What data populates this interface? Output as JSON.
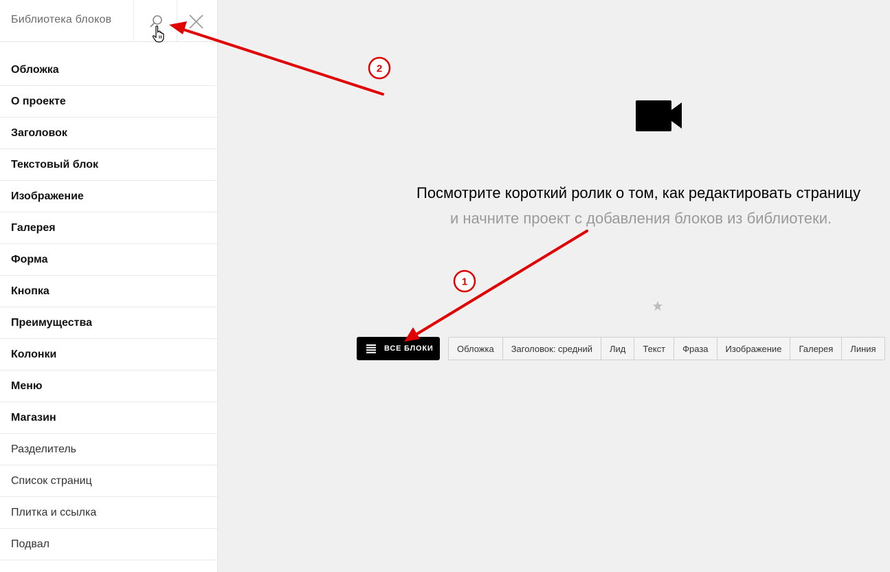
{
  "sidebar": {
    "title": "Библиотека блоков",
    "items": [
      {
        "label": "Обложка"
      },
      {
        "label": "О проекте"
      },
      {
        "label": "Заголовок"
      },
      {
        "label": "Текстовый блок"
      },
      {
        "label": "Изображение"
      },
      {
        "label": "Галерея"
      },
      {
        "label": "Форма"
      },
      {
        "label": "Кнопка"
      },
      {
        "label": "Преимущества"
      },
      {
        "label": "Колонки"
      },
      {
        "label": "Меню"
      },
      {
        "label": "Магазин"
      },
      {
        "label": "Разделитель"
      },
      {
        "label": "Список страниц"
      },
      {
        "label": "Плитка и ссылка"
      },
      {
        "label": "Подвал"
      }
    ]
  },
  "main": {
    "headline": "Посмотрите короткий ролик о том, как редактировать страницу",
    "subline": "и начните проект с добавления блоков из библиотеки.",
    "all_blocks_label": "ВСЕ БЛОКИ",
    "chips": [
      "Обложка",
      "Заголовок: средний",
      "Лид",
      "Текст",
      "Фраза",
      "Изображение",
      "Галерея",
      "Линия"
    ]
  },
  "annotations": {
    "badge_1": "1",
    "badge_2": "2",
    "color": "#e00000"
  }
}
